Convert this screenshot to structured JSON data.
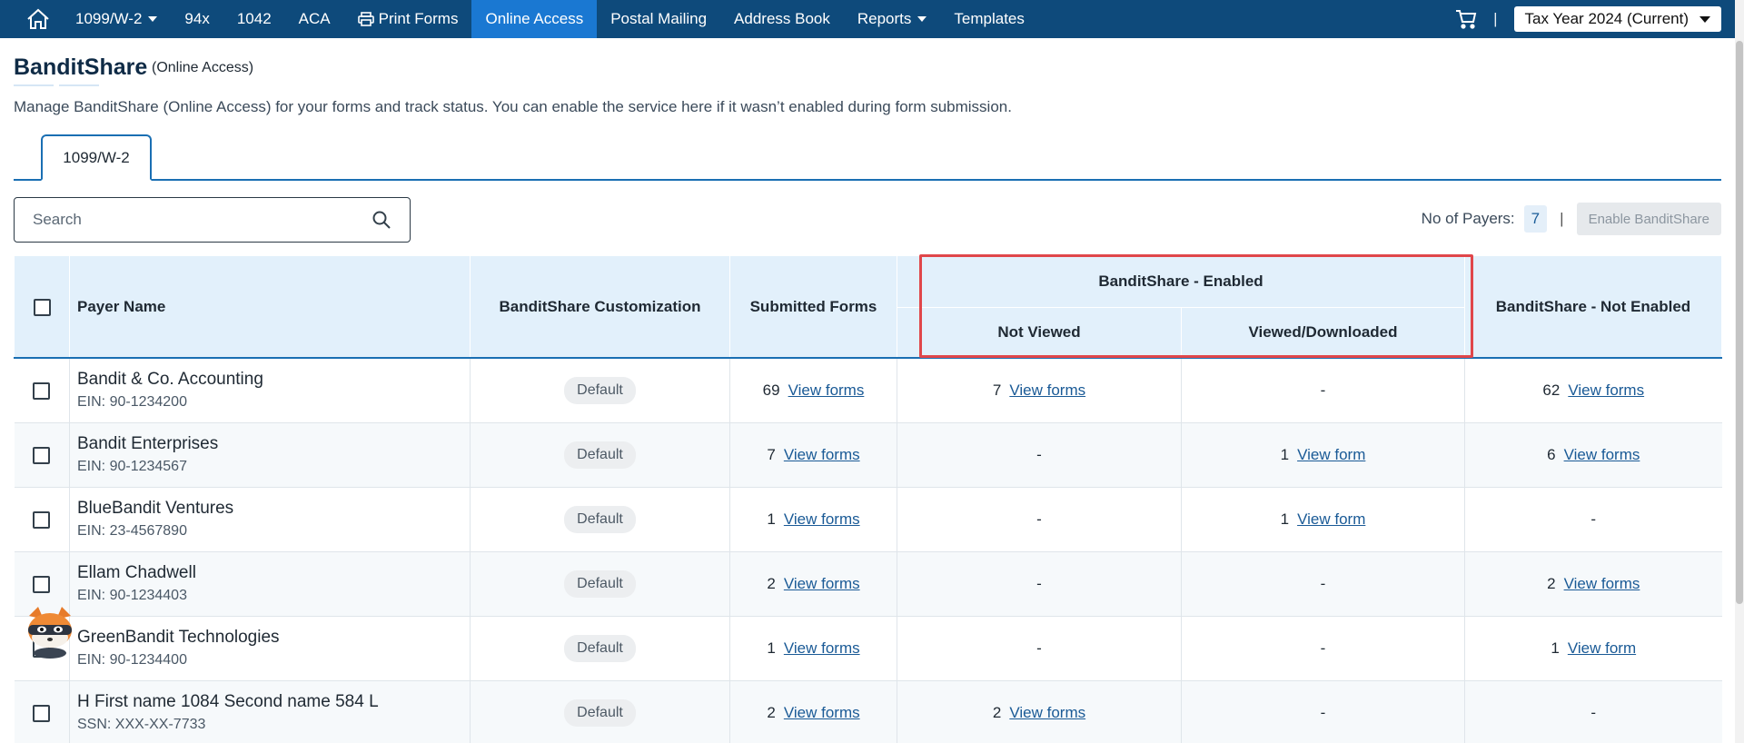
{
  "nav": {
    "items": [
      {
        "label": "1099/W-2",
        "dropdown": true
      },
      {
        "label": "94x",
        "dropdown": false
      },
      {
        "label": "1042",
        "dropdown": false
      },
      {
        "label": "ACA",
        "dropdown": false
      },
      {
        "label": "Print Forms",
        "dropdown": false,
        "icon": "printer-icon"
      },
      {
        "label": "Online Access",
        "dropdown": false,
        "active": true
      },
      {
        "label": "Postal Mailing",
        "dropdown": false
      },
      {
        "label": "Address Book",
        "dropdown": false
      },
      {
        "label": "Reports",
        "dropdown": true
      },
      {
        "label": "Templates",
        "dropdown": false
      }
    ],
    "separator": "|",
    "tax_year": "Tax Year 2024 (Current)",
    "colors": {
      "bar": "#0e4a7b",
      "active": "#1a78d2"
    }
  },
  "header": {
    "title": "BanditShare",
    "subtitle": "(Online Access)",
    "description": "Manage BanditShare (Online Access) for your forms and track status. You can enable the service here if it wasn’t enabled during form submission."
  },
  "tabs": [
    {
      "label": "1099/W-2",
      "active": true
    }
  ],
  "search": {
    "placeholder": "Search"
  },
  "toolbar": {
    "payers_label": "No of Payers:",
    "payers_count": "7",
    "separator": "|",
    "enable_label": "Enable BanditShare"
  },
  "table": {
    "headers": {
      "payer_name": "Payer Name",
      "customization": "BanditShare Customization",
      "submitted": "Submitted Forms",
      "enabled_group": "BanditShare - Enabled",
      "not_viewed": "Not Viewed",
      "viewed": "Viewed/Downloaded",
      "not_enabled": "BanditShare - Not Enabled"
    },
    "rows": [
      {
        "name": "Bandit & Co. Accounting",
        "id": "EIN: 90-1234200",
        "customization": "Default",
        "submitted": {
          "count": "69",
          "link": "View forms"
        },
        "not_viewed": {
          "count": "7",
          "link": "View forms"
        },
        "viewed": {
          "dash": "-"
        },
        "not_enabled": {
          "count": "62",
          "link": "View forms"
        }
      },
      {
        "name": "Bandit Enterprises",
        "id": "EIN: 90-1234567",
        "customization": "Default",
        "submitted": {
          "count": "7",
          "link": "View forms"
        },
        "not_viewed": {
          "dash": "-"
        },
        "viewed": {
          "count": "1",
          "link": "View form"
        },
        "not_enabled": {
          "count": "6",
          "link": "View forms"
        }
      },
      {
        "name": "BlueBandit Ventures",
        "id": "EIN: 23-4567890",
        "customization": "Default",
        "submitted": {
          "count": "1",
          "link": "View forms"
        },
        "not_viewed": {
          "dash": "-"
        },
        "viewed": {
          "count": "1",
          "link": "View form"
        },
        "not_enabled": {
          "dash": "-"
        }
      },
      {
        "name": "Ellam Chadwell",
        "id": "EIN: 90-1234403",
        "customization": "Default",
        "submitted": {
          "count": "2",
          "link": "View forms"
        },
        "not_viewed": {
          "dash": "-"
        },
        "viewed": {
          "dash": "-"
        },
        "not_enabled": {
          "count": "2",
          "link": "View forms"
        }
      },
      {
        "name": "GreenBandit Technologies",
        "id": "EIN: 90-1234400",
        "customization": "Default",
        "submitted": {
          "count": "1",
          "link": "View forms"
        },
        "not_viewed": {
          "dash": "-"
        },
        "viewed": {
          "dash": "-"
        },
        "not_enabled": {
          "count": "1",
          "link": "View form"
        }
      },
      {
        "name": "H First name 1084 Second name 584 L",
        "id": "SSN: XXX-XX-7733",
        "customization": "Default",
        "submitted": {
          "count": "2",
          "link": "View forms"
        },
        "not_viewed": {
          "count": "2",
          "link": "View forms"
        },
        "viewed": {
          "dash": "-"
        },
        "not_enabled": {
          "dash": "-"
        }
      }
    ]
  }
}
